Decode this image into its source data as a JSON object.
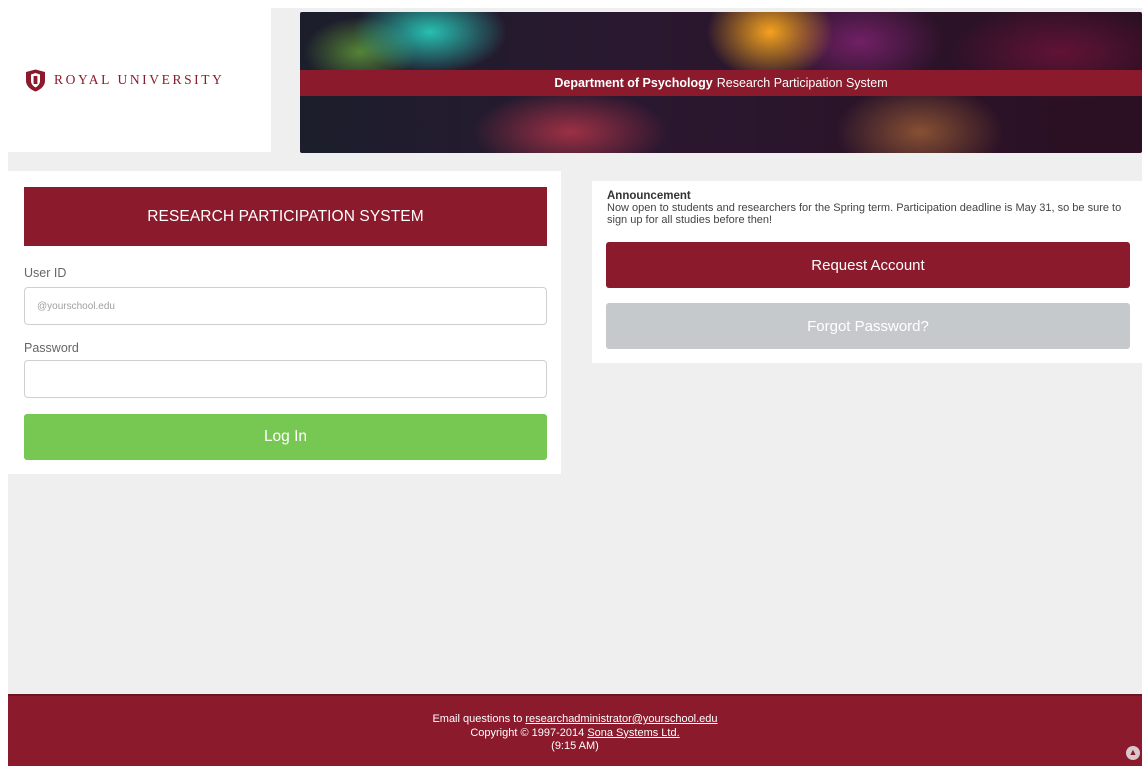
{
  "brand": {
    "logo_text": "ROYAL UNIVERSITY",
    "banner_bold": "Department of Psychology",
    "banner_rest": "Research Participation System",
    "color_primary": "#8a1a2c"
  },
  "login": {
    "header": "RESEARCH PARTICIPATION SYSTEM",
    "userid_label": "User ID",
    "userid_placeholder": "@yourschool.edu",
    "password_label": "Password",
    "login_button": "Log In"
  },
  "info": {
    "announcement_title": "Announcement",
    "announcement_body": "Now open to students and researchers for the Spring term. Participation deadline is May 31, so be sure to sign up for all studies before then!",
    "request_button": "Request Account",
    "forgot_button": "Forgot Password?"
  },
  "footer": {
    "email_prefix": "Email questions to",
    "email": "researchadministrator@yourschool.edu",
    "copyright_prefix": "Copyright © 1997-2014",
    "company": "Sona Systems Ltd.",
    "time": "(9:15 AM)"
  }
}
